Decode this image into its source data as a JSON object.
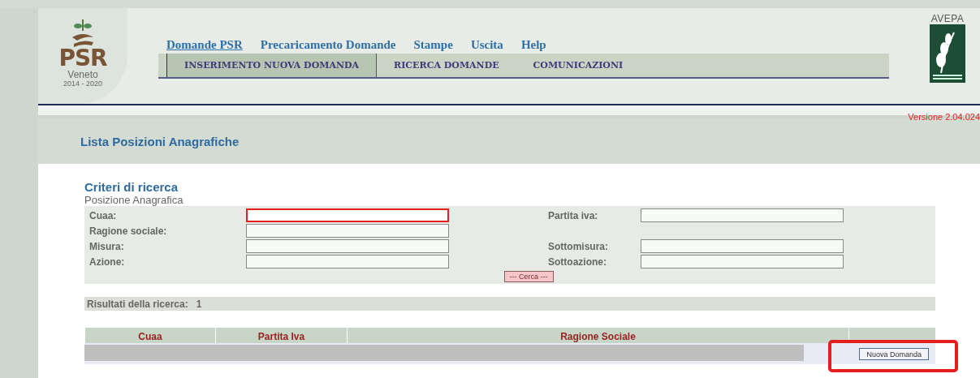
{
  "logo": {
    "title": "PSR",
    "region": "Veneto",
    "years": "2014 - 2020"
  },
  "menu": [
    {
      "label": "Domande PSR",
      "selected": true
    },
    {
      "label": "Precaricamento Domande",
      "selected": false
    },
    {
      "label": "Stampe",
      "selected": false
    },
    {
      "label": "Uscita",
      "selected": false
    },
    {
      "label": "Help",
      "selected": false
    }
  ],
  "tabs": [
    {
      "label": "INSERIMENTO NUOVA DOMANDA",
      "selected": true
    },
    {
      "label": "RICERCA DOMANDE",
      "selected": false
    },
    {
      "label": "COMUNICAZIONI",
      "selected": false
    }
  ],
  "agency_logo": {
    "name": "AVEPA"
  },
  "version": "Versione 2.04.024",
  "page_title": "Lista Posizioni Anagrafiche",
  "search": {
    "title": "Criteri di ricerca",
    "subtitle": "Posizione Anagrafica",
    "rows": [
      [
        {
          "label": "Cuaa:",
          "highlighted": true
        },
        {
          "label": "Partita iva:",
          "highlighted": false
        }
      ],
      [
        {
          "label": "Ragione sociale:",
          "highlighted": false
        },
        null
      ],
      [
        {
          "label": "Misura:",
          "highlighted": false
        },
        {
          "label": "Sottomisura:",
          "highlighted": false
        }
      ],
      [
        {
          "label": "Azione:",
          "highlighted": false
        },
        {
          "label": "Sottoazione:",
          "highlighted": false
        }
      ]
    ],
    "button": "--- Cerca ---"
  },
  "results": {
    "label": "Risultati della ricerca:",
    "count": "1"
  },
  "table": {
    "columns": [
      "Cuaa",
      "Partita Iva",
      "Ragione Sociale",
      ""
    ],
    "rows": [
      {
        "redacted": true,
        "action": "Nuova Domanda",
        "highlighted": true
      }
    ]
  }
}
